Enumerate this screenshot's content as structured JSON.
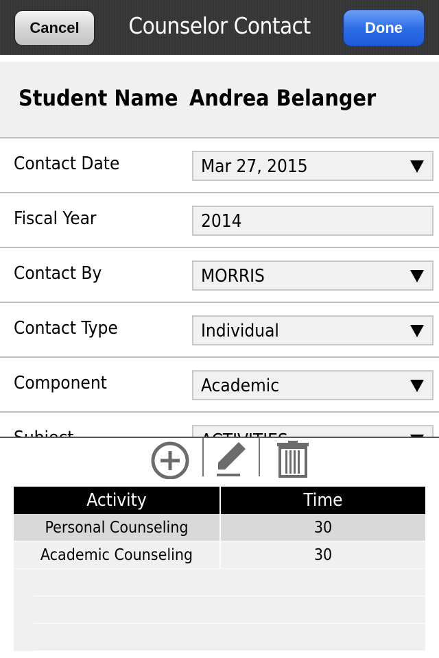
{
  "navbar": {
    "title": "Counselor Contact",
    "cancel_label": "Cancel",
    "done_label": "Done"
  },
  "student": {
    "label": "Student Name",
    "value": "Andrea Belanger"
  },
  "form": {
    "rows": [
      {
        "label": "Contact Date",
        "value": "Mar 27, 2015",
        "dropdown": true
      },
      {
        "label": "Fiscal Year",
        "value": "2014",
        "dropdown": false
      },
      {
        "label": "Contact By",
        "value": "MORRIS",
        "dropdown": true
      },
      {
        "label": "Contact Type",
        "value": "Individual",
        "dropdown": true
      },
      {
        "label": "Component",
        "value": "Academic",
        "dropdown": true
      },
      {
        "label": "Subject",
        "value": "ACTIVITIES",
        "dropdown": true
      }
    ]
  },
  "toolbar": {
    "icons": [
      "add-circle-icon",
      "edit-pencil-icon",
      "trash-icon"
    ],
    "icon_color": "#6b6b6b"
  },
  "activities": {
    "columns": [
      "Activity",
      "Time"
    ],
    "rows": [
      {
        "activity": "Personal Counseling",
        "time": "30",
        "selected": true
      },
      {
        "activity": "Academic Counseling",
        "time": "30",
        "selected": false
      }
    ]
  },
  "colors": {
    "navbar_bg": "#383838",
    "done_blue": "#2d6ee8",
    "table_header_bg": "#000000",
    "selected_row_bg": "#d9d9d9",
    "row_bg": "#f0f0f0"
  }
}
